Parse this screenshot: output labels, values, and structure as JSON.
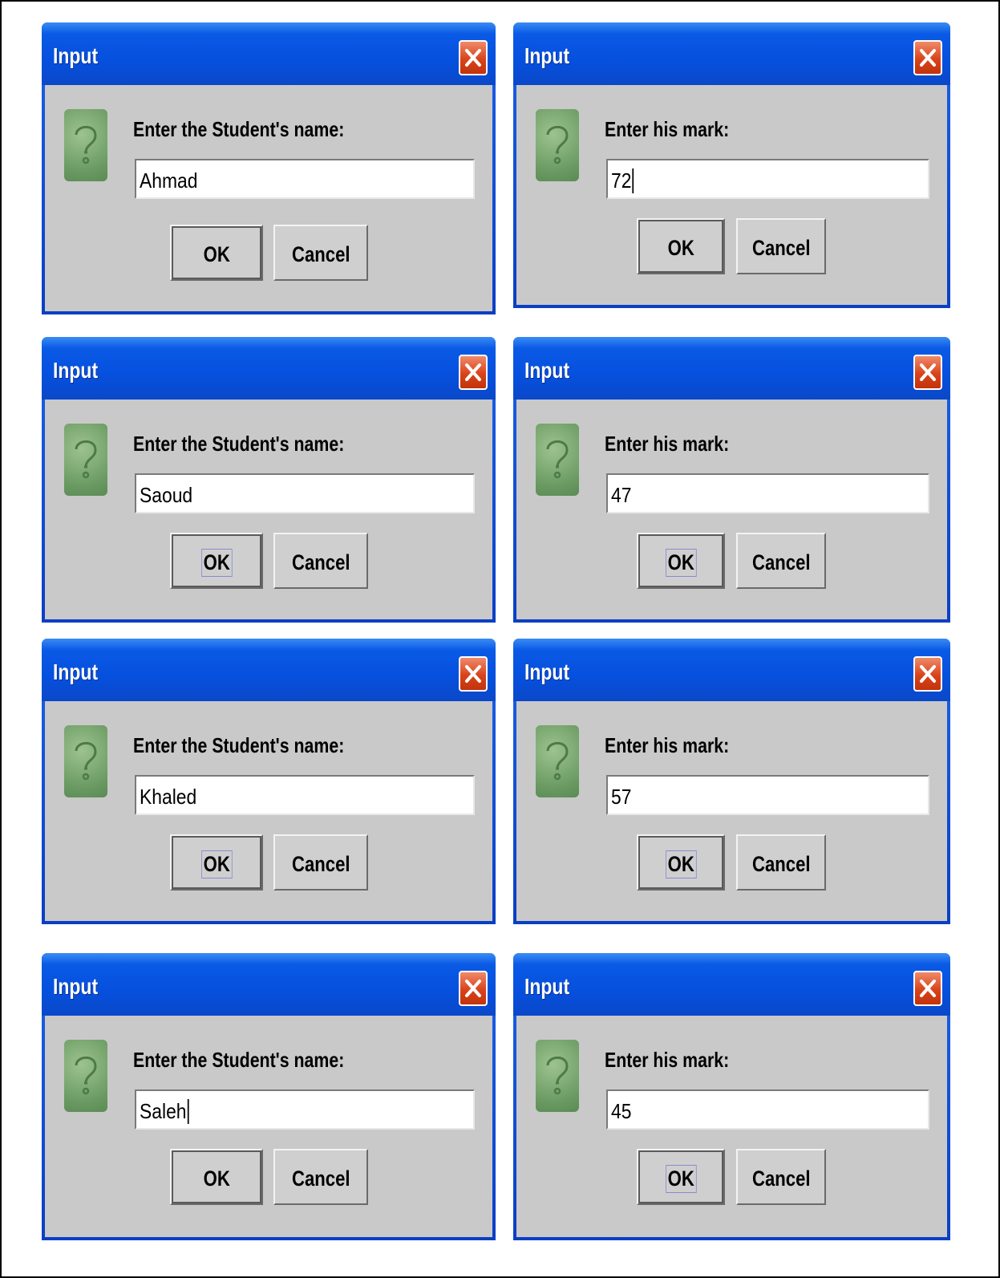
{
  "dialogs": [
    {
      "title": "Input",
      "prompt": "Enter the Student's name:",
      "value": "Ahmad",
      "ok": "OK",
      "cancel": "Cancel"
    },
    {
      "title": "Input",
      "prompt": "Enter his mark:",
      "value": "72",
      "ok": "OK",
      "cancel": "Cancel"
    },
    {
      "title": "Input",
      "prompt": "Enter the Student's name:",
      "value": "Saoud",
      "ok": "OK",
      "cancel": "Cancel"
    },
    {
      "title": "Input",
      "prompt": "Enter his mark:",
      "value": "47",
      "ok": "OK",
      "cancel": "Cancel"
    },
    {
      "title": "Input",
      "prompt": "Enter the Student's name:",
      "value": "Khaled",
      "ok": "OK",
      "cancel": "Cancel"
    },
    {
      "title": "Input",
      "prompt": "Enter his mark:",
      "value": "57",
      "ok": "OK",
      "cancel": "Cancel"
    },
    {
      "title": "Input",
      "prompt": "Enter the Student's name:",
      "value": "Saleh",
      "ok": "OK",
      "cancel": "Cancel"
    },
    {
      "title": "Input",
      "prompt": "Enter his mark:",
      "value": "45",
      "ok": "OK",
      "cancel": "Cancel"
    }
  ],
  "icons": {
    "question": "question-mark-icon",
    "close": "close-icon"
  },
  "colors": {
    "titlebar": "#0a5ae6",
    "client": "#c9c9c9",
    "close": "#d9431a",
    "icon": "#6a9a62"
  }
}
